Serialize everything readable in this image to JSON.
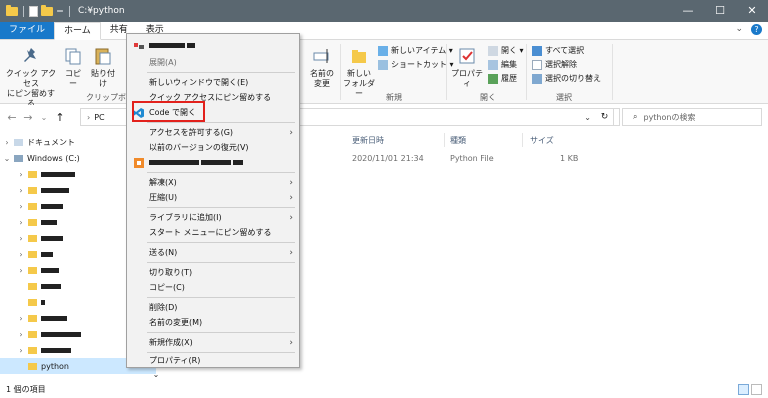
{
  "window": {
    "title": "C:¥python",
    "controls": [
      "—",
      "☐",
      "✕"
    ]
  },
  "ribbon_tabs": [
    "ファイル",
    "ホーム",
    "共有",
    "表示"
  ],
  "ribbon": {
    "pin_label": "クイック アクセス\nにピン留めする",
    "copy_label": "コピー",
    "paste_label": "貼り付け",
    "clipboard_group": "クリップボード",
    "move_label": "名前の\n変更",
    "new_folder_label": "新しい\nフォルダー",
    "new_item_label": "新しいアイテム ▾",
    "shortcut_label": "ショートカット ▾",
    "new_group": "新規",
    "properties_label": "プロパティ",
    "open_label": "開く ▾",
    "edit_label": "編集",
    "history_label": "履歴",
    "open_group": "開く",
    "select_all_label": "すべて選択",
    "select_none_label": "選択解除",
    "invert_label": "選択の切り替え",
    "select_group": "選択"
  },
  "address": {
    "path_pc": "PC",
    "search_placeholder": "pythonの検索"
  },
  "nav_tree": [
    {
      "label": "ドキュメント",
      "chevron": "›"
    },
    {
      "label": "Windows (C:)",
      "chevron": "⌄"
    },
    {
      "label": "python",
      "chevron": ""
    }
  ],
  "columns": [
    "更新日時",
    "種類",
    "サイズ"
  ],
  "file_row": {
    "modified": "2020/11/01 21:34",
    "type": "Python File",
    "size": "1 KB"
  },
  "status": {
    "count": "1 個の項目"
  },
  "context_menu": {
    "items": [
      {
        "label": "展開(A)",
        "disabled": true
      },
      {
        "label": "新しいウィンドウで開く(E)"
      },
      {
        "label": "クイック アクセスにピン留めする"
      },
      {
        "label": "Code で開く"
      },
      {
        "label": "アクセスを許可する(G)",
        "submenu": true
      },
      {
        "label": "以前のバージョンの復元(V)"
      },
      {
        "label": "解凍(X)",
        "submenu": true
      },
      {
        "label": "圧縮(U)",
        "submenu": true
      },
      {
        "label": "ライブラリに追加(I)",
        "submenu": true
      },
      {
        "label": "スタート メニューにピン留めする"
      },
      {
        "label": "送る(N)",
        "submenu": true
      },
      {
        "label": "切り取り(T)"
      },
      {
        "label": "コピー(C)"
      },
      {
        "label": "削除(D)"
      },
      {
        "label": "名前の変更(M)"
      },
      {
        "label": "新規作成(X)",
        "submenu": true
      },
      {
        "label": "プロパティ(R)"
      }
    ],
    "arrow": "›"
  },
  "colors": {
    "titlebar": "#5a6770",
    "file_tab": "#1979ca",
    "folder": "#f5c94a",
    "selection": "#cce8ff",
    "highlight_border": "#e2211c",
    "vscode_blue": "#1f8ad2"
  },
  "icons": {
    "back": "←",
    "forward": "→",
    "up": "↑",
    "refresh": "↻",
    "search": "⌕",
    "chevron_down": "⌄",
    "help": "?"
  }
}
